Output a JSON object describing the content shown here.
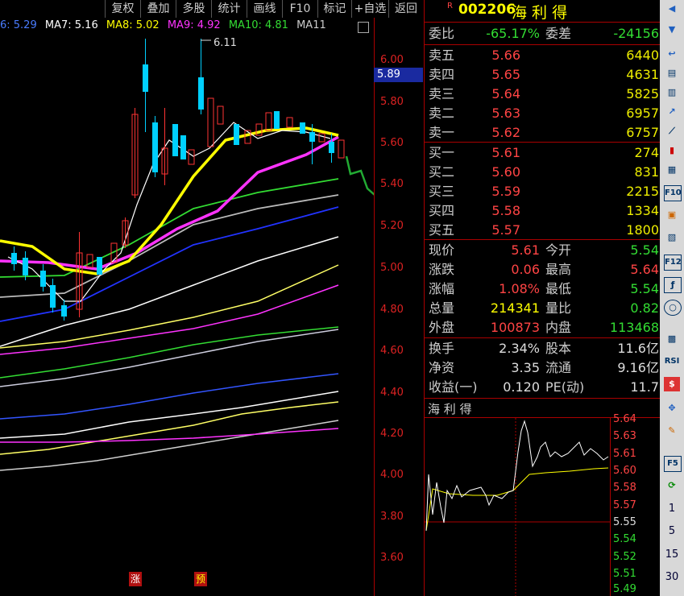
{
  "toolbar": {
    "items": [
      "复权",
      "叠加",
      "多股",
      "统计",
      "画线",
      "F10",
      "标记",
      "+自选",
      "返回"
    ]
  },
  "ma_legend": [
    {
      "label": "6: 5.29",
      "color": "#4a7cff"
    },
    {
      "label": "MA7: 5.16",
      "color": "#ffffff"
    },
    {
      "label": "MA8: 5.02",
      "color": "#ffff00"
    },
    {
      "label": "MA9: 4.92",
      "color": "#ff33ff"
    },
    {
      "label": "MA10: 4.81",
      "color": "#33dd33"
    },
    {
      "label": "MA11",
      "color": "#cccccc"
    }
  ],
  "chart": {
    "y_ticks": [
      "6.00",
      "5.80",
      "5.60",
      "5.40",
      "5.20",
      "5.00",
      "4.80",
      "4.60",
      "4.40",
      "4.20",
      "4.00",
      "3.80",
      "3.60"
    ],
    "current_price_label": "5.89",
    "high_annotation": "6.11",
    "markers": [
      "涨",
      "预"
    ]
  },
  "stock": {
    "badge": "R",
    "code": "002206",
    "name": "海 利 得"
  },
  "order_ratio": {
    "label1": "委比",
    "value1": "-65.17%",
    "label2": "委差",
    "value2": "-24156"
  },
  "asks": [
    {
      "label": "卖五",
      "price": "5.66",
      "volume": "6440"
    },
    {
      "label": "卖四",
      "price": "5.65",
      "volume": "4631"
    },
    {
      "label": "卖三",
      "price": "5.64",
      "volume": "5825"
    },
    {
      "label": "卖二",
      "price": "5.63",
      "volume": "6957"
    },
    {
      "label": "卖一",
      "price": "5.62",
      "volume": "6757"
    }
  ],
  "bids": [
    {
      "label": "买一",
      "price": "5.61",
      "volume": "274"
    },
    {
      "label": "买二",
      "price": "5.60",
      "volume": "831"
    },
    {
      "label": "买三",
      "price": "5.59",
      "volume": "2215"
    },
    {
      "label": "买四",
      "price": "5.58",
      "volume": "1334"
    },
    {
      "label": "买五",
      "price": "5.57",
      "volume": "1800"
    }
  ],
  "stats": [
    {
      "l1": "现价",
      "v1": "5.61",
      "c1": "#ff4444",
      "l2": "今开",
      "v2": "5.54",
      "c2": "#33dd33"
    },
    {
      "l1": "涨跌",
      "v1": "0.06",
      "c1": "#ff4444",
      "l2": "最高",
      "v2": "5.64",
      "c2": "#ff4444"
    },
    {
      "l1": "涨幅",
      "v1": "1.08%",
      "c1": "#ff4444",
      "l2": "最低",
      "v2": "5.54",
      "c2": "#33dd33"
    },
    {
      "l1": "总量",
      "v1": "214341",
      "c1": "#ffff00",
      "l2": "量比",
      "v2": "0.82",
      "c2": "#33dd33"
    },
    {
      "l1": "外盘",
      "v1": "100873",
      "c1": "#ff4444",
      "l2": "内盘",
      "v2": "113468",
      "c2": "#33dd33"
    }
  ],
  "stats2": [
    {
      "l1": "换手",
      "v1": "2.34%",
      "l2": "股本",
      "v2": "11.6亿"
    },
    {
      "l1": "净资",
      "v1": "3.35",
      "l2": "流通",
      "v2": "9.16亿"
    },
    {
      "l1": "收益(一)",
      "v1": "0.120",
      "l2": "PE(动)",
      "v2": "11.7"
    }
  ],
  "mini_chart": {
    "title": "海 利 得",
    "y_ticks": [
      "5.64",
      "5.63",
      "5.61",
      "5.60",
      "5.58",
      "5.57",
      "5.55",
      "5.54",
      "5.52",
      "5.51",
      "5.49"
    ]
  },
  "right_toolbar": {
    "numbers": [
      "1",
      "5",
      "15",
      "30"
    ]
  }
}
